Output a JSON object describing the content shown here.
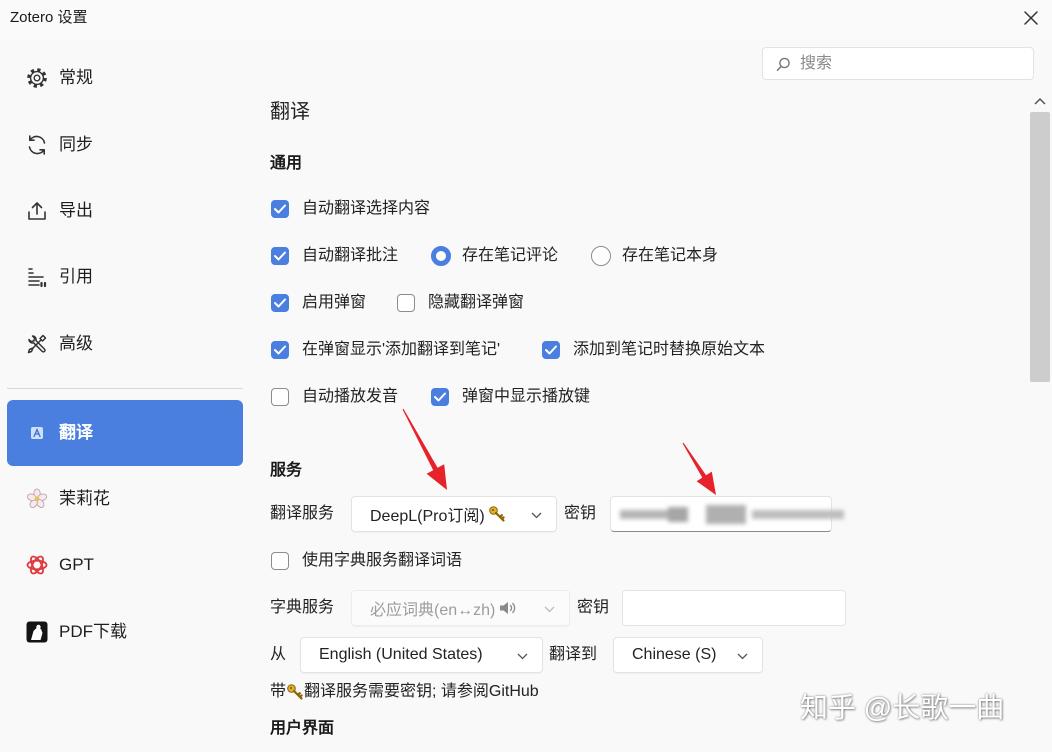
{
  "window": {
    "title": "Zotero 设置"
  },
  "search": {
    "placeholder": "搜索"
  },
  "sidebar": {
    "items": [
      {
        "label": "常规",
        "icon": "gear-icon",
        "selected": false
      },
      {
        "label": "同步",
        "icon": "sync-icon",
        "selected": false
      },
      {
        "label": "导出",
        "icon": "export-icon",
        "selected": false
      },
      {
        "label": "引用",
        "icon": "cite-icon",
        "selected": false
      },
      {
        "label": "高级",
        "icon": "tools-icon",
        "selected": false
      },
      {
        "label": "翻译",
        "icon": "translate-icon",
        "selected": true
      },
      {
        "label": "茉莉花",
        "icon": "jasmine-icon",
        "selected": false
      },
      {
        "label": "GPT",
        "icon": "gpt-icon",
        "selected": false
      },
      {
        "label": "PDF下载",
        "icon": "pdf-download-icon",
        "selected": false
      }
    ]
  },
  "main": {
    "title": "翻译",
    "general": {
      "heading": "通用",
      "auto_translate_selection": {
        "label": "自动翻译选择内容",
        "checked": true
      },
      "auto_translate_annotation": {
        "label": "自动翻译批注",
        "checked": true
      },
      "store_in_comment": {
        "label": "存在笔记评论",
        "selected": true
      },
      "store_in_body": {
        "label": "存在笔记本身",
        "selected": false
      },
      "enable_popup": {
        "label": "启用弹窗",
        "checked": true
      },
      "hide_popup": {
        "label": "隐藏翻译弹窗",
        "checked": false
      },
      "show_add_to_note": {
        "label": "在弹窗显示'添加翻译到笔记'",
        "checked": true
      },
      "replace_original": {
        "label": "添加到笔记时替换原始文本",
        "checked": true
      },
      "autoplay_pronunciation": {
        "label": "自动播放发音",
        "checked": false
      },
      "show_play_button": {
        "label": "弹窗中显示播放键",
        "checked": true
      }
    },
    "services": {
      "heading": "服务",
      "translate_service": {
        "label": "翻译服务",
        "value": "DeepL(Pro订阅)",
        "value_icon": "key-icon"
      },
      "translate_key": {
        "label": "密钥"
      },
      "use_dict": {
        "label": "使用字典服务翻译词语",
        "checked": false
      },
      "dict_service": {
        "label": "字典服务",
        "value": "必应词典(en↔zh)",
        "value_icon": "speaker-icon",
        "disabled": true
      },
      "dict_key": {
        "label": "密钥",
        "value": ""
      },
      "from": {
        "label": "从",
        "value": "English (United States)"
      },
      "to": {
        "label": "翻译到",
        "value": "Chinese (S)"
      },
      "note": {
        "prefix": "带",
        "icon": "key-icon",
        "suffix": "翻译服务需要密钥; 请参阅GitHub"
      }
    },
    "ui_section": {
      "heading": "用户界面"
    }
  },
  "watermark": {
    "text": "知乎 @长歌一曲"
  },
  "colors": {
    "accent": "#4a7fe0",
    "annotation_arrow": "#e6232a"
  }
}
